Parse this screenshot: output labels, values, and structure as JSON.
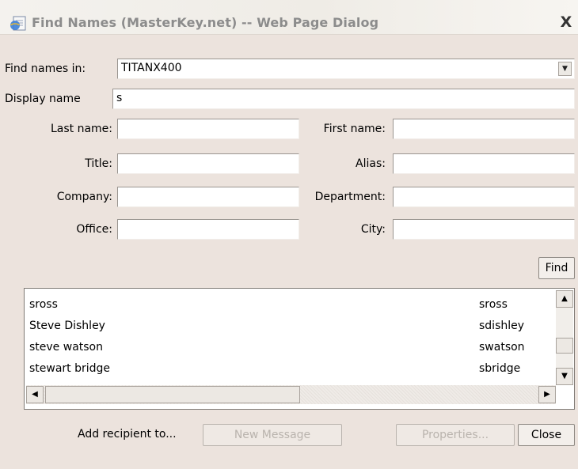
{
  "window": {
    "title": "Find Names (MasterKey.net) -- Web Page Dialog",
    "close_glyph": "X",
    "icon": "ie-page-icon"
  },
  "find_in": {
    "label": "Find names in:",
    "value": "TITANX400",
    "dropdown_glyph": "▼"
  },
  "display_name": {
    "label": "Display name",
    "value": "s"
  },
  "fields": {
    "last_name": {
      "label": "Last name:",
      "value": ""
    },
    "first_name": {
      "label": "First name:",
      "value": ""
    },
    "title": {
      "label": "Title:",
      "value": ""
    },
    "alias": {
      "label": "Alias:",
      "value": ""
    },
    "company": {
      "label": "Company:",
      "value": ""
    },
    "department": {
      "label": "Department:",
      "value": ""
    },
    "office": {
      "label": "Office:",
      "value": ""
    },
    "city": {
      "label": "City:",
      "value": ""
    }
  },
  "find_button": "Find",
  "results": [
    {
      "name": "sross",
      "alias": "sross"
    },
    {
      "name": "Steve Dishley",
      "alias": "sdishley"
    },
    {
      "name": "steve watson",
      "alias": "swatson"
    },
    {
      "name": "stewart bridge",
      "alias": "sbridge"
    }
  ],
  "scroll_glyphs": {
    "up": "▲",
    "down": "▼",
    "left": "◀",
    "right": "▶"
  },
  "footer": {
    "add_recipient_label": "Add recipient to...",
    "new_message": "New Message",
    "properties": "Properties...",
    "close": "Close"
  },
  "colors": {
    "dialog_bg": "#ece3dd",
    "title_text": "#8c8c8c",
    "disabled_text": "#b9b3ad"
  }
}
